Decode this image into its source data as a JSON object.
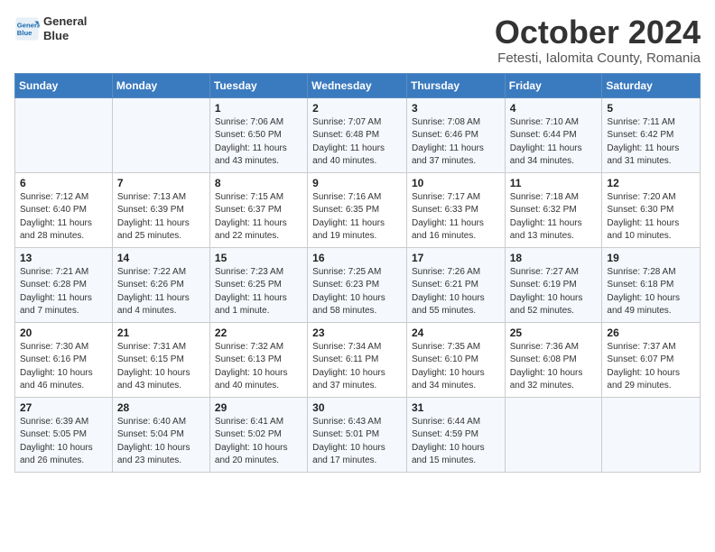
{
  "header": {
    "logo_line1": "General",
    "logo_line2": "Blue",
    "title": "October 2024",
    "subtitle": "Fetesti, Ialomita County, Romania"
  },
  "weekdays": [
    "Sunday",
    "Monday",
    "Tuesday",
    "Wednesday",
    "Thursday",
    "Friday",
    "Saturday"
  ],
  "weeks": [
    [
      {
        "day": "",
        "info": ""
      },
      {
        "day": "",
        "info": ""
      },
      {
        "day": "1",
        "info": "Sunrise: 7:06 AM\nSunset: 6:50 PM\nDaylight: 11 hours and 43 minutes."
      },
      {
        "day": "2",
        "info": "Sunrise: 7:07 AM\nSunset: 6:48 PM\nDaylight: 11 hours and 40 minutes."
      },
      {
        "day": "3",
        "info": "Sunrise: 7:08 AM\nSunset: 6:46 PM\nDaylight: 11 hours and 37 minutes."
      },
      {
        "day": "4",
        "info": "Sunrise: 7:10 AM\nSunset: 6:44 PM\nDaylight: 11 hours and 34 minutes."
      },
      {
        "day": "5",
        "info": "Sunrise: 7:11 AM\nSunset: 6:42 PM\nDaylight: 11 hours and 31 minutes."
      }
    ],
    [
      {
        "day": "6",
        "info": "Sunrise: 7:12 AM\nSunset: 6:40 PM\nDaylight: 11 hours and 28 minutes."
      },
      {
        "day": "7",
        "info": "Sunrise: 7:13 AM\nSunset: 6:39 PM\nDaylight: 11 hours and 25 minutes."
      },
      {
        "day": "8",
        "info": "Sunrise: 7:15 AM\nSunset: 6:37 PM\nDaylight: 11 hours and 22 minutes."
      },
      {
        "day": "9",
        "info": "Sunrise: 7:16 AM\nSunset: 6:35 PM\nDaylight: 11 hours and 19 minutes."
      },
      {
        "day": "10",
        "info": "Sunrise: 7:17 AM\nSunset: 6:33 PM\nDaylight: 11 hours and 16 minutes."
      },
      {
        "day": "11",
        "info": "Sunrise: 7:18 AM\nSunset: 6:32 PM\nDaylight: 11 hours and 13 minutes."
      },
      {
        "day": "12",
        "info": "Sunrise: 7:20 AM\nSunset: 6:30 PM\nDaylight: 11 hours and 10 minutes."
      }
    ],
    [
      {
        "day": "13",
        "info": "Sunrise: 7:21 AM\nSunset: 6:28 PM\nDaylight: 11 hours and 7 minutes."
      },
      {
        "day": "14",
        "info": "Sunrise: 7:22 AM\nSunset: 6:26 PM\nDaylight: 11 hours and 4 minutes."
      },
      {
        "day": "15",
        "info": "Sunrise: 7:23 AM\nSunset: 6:25 PM\nDaylight: 11 hours and 1 minute."
      },
      {
        "day": "16",
        "info": "Sunrise: 7:25 AM\nSunset: 6:23 PM\nDaylight: 10 hours and 58 minutes."
      },
      {
        "day": "17",
        "info": "Sunrise: 7:26 AM\nSunset: 6:21 PM\nDaylight: 10 hours and 55 minutes."
      },
      {
        "day": "18",
        "info": "Sunrise: 7:27 AM\nSunset: 6:19 PM\nDaylight: 10 hours and 52 minutes."
      },
      {
        "day": "19",
        "info": "Sunrise: 7:28 AM\nSunset: 6:18 PM\nDaylight: 10 hours and 49 minutes."
      }
    ],
    [
      {
        "day": "20",
        "info": "Sunrise: 7:30 AM\nSunset: 6:16 PM\nDaylight: 10 hours and 46 minutes."
      },
      {
        "day": "21",
        "info": "Sunrise: 7:31 AM\nSunset: 6:15 PM\nDaylight: 10 hours and 43 minutes."
      },
      {
        "day": "22",
        "info": "Sunrise: 7:32 AM\nSunset: 6:13 PM\nDaylight: 10 hours and 40 minutes."
      },
      {
        "day": "23",
        "info": "Sunrise: 7:34 AM\nSunset: 6:11 PM\nDaylight: 10 hours and 37 minutes."
      },
      {
        "day": "24",
        "info": "Sunrise: 7:35 AM\nSunset: 6:10 PM\nDaylight: 10 hours and 34 minutes."
      },
      {
        "day": "25",
        "info": "Sunrise: 7:36 AM\nSunset: 6:08 PM\nDaylight: 10 hours and 32 minutes."
      },
      {
        "day": "26",
        "info": "Sunrise: 7:37 AM\nSunset: 6:07 PM\nDaylight: 10 hours and 29 minutes."
      }
    ],
    [
      {
        "day": "27",
        "info": "Sunrise: 6:39 AM\nSunset: 5:05 PM\nDaylight: 10 hours and 26 minutes."
      },
      {
        "day": "28",
        "info": "Sunrise: 6:40 AM\nSunset: 5:04 PM\nDaylight: 10 hours and 23 minutes."
      },
      {
        "day": "29",
        "info": "Sunrise: 6:41 AM\nSunset: 5:02 PM\nDaylight: 10 hours and 20 minutes."
      },
      {
        "day": "30",
        "info": "Sunrise: 6:43 AM\nSunset: 5:01 PM\nDaylight: 10 hours and 17 minutes."
      },
      {
        "day": "31",
        "info": "Sunrise: 6:44 AM\nSunset: 4:59 PM\nDaylight: 10 hours and 15 minutes."
      },
      {
        "day": "",
        "info": ""
      },
      {
        "day": "",
        "info": ""
      }
    ]
  ]
}
